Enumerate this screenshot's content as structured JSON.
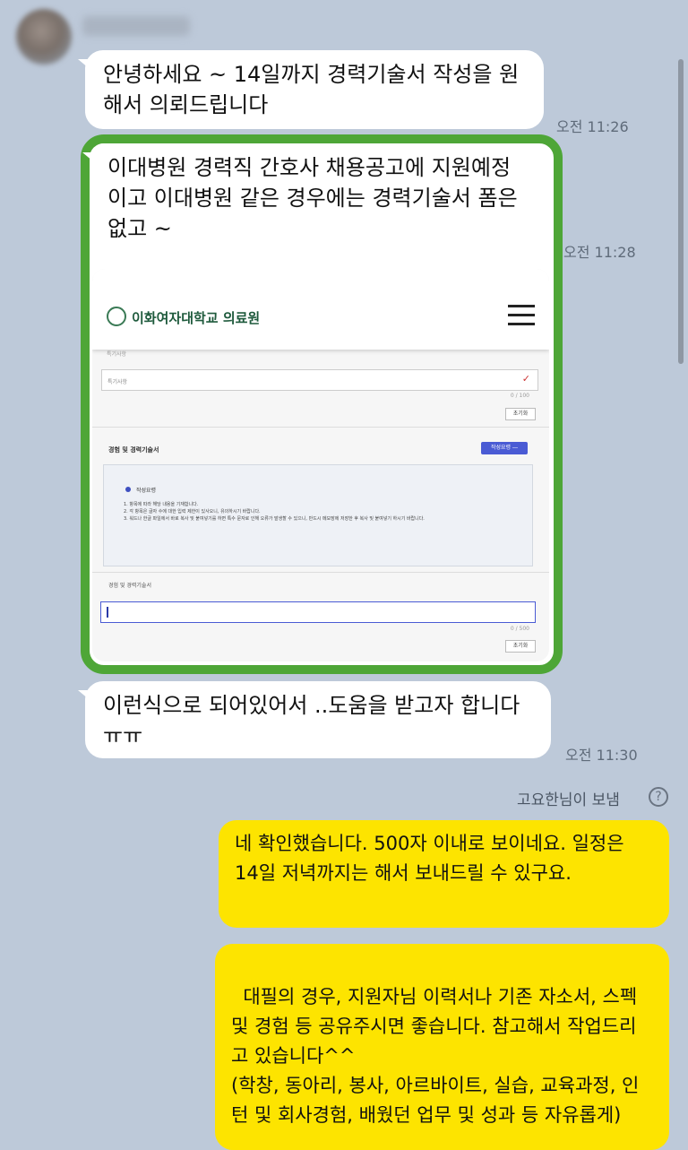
{
  "chat": {
    "messages": [
      {
        "text": "안녕하세요 ~ 14일까지 경력기술서 작성을 원해서 의뢰드립니다",
        "time": "오전 11:26"
      },
      {
        "text": "이대병원 경력직 간호사 채용공고에 지원예정이고 이대병원 같은 경우에는 경력기술서 폼은 없고 ~",
        "time": "오전 11:28"
      },
      {
        "text": "이런식으로 되어있어서 ..도움을 받고자 합니다 ㅠㅠ",
        "time": "오전 11:30"
      }
    ],
    "sent_by_label": "고요한님이 보냄",
    "help_icon": "?",
    "replies": [
      {
        "text": "네 확인했습니다. 500자 이내로 보이네요. 일정은 14일 저녁까지는 해서 보내드릴 수 있구요."
      },
      {
        "text": "대필의 경우, 지원자님 이력서나 기존 자소서, 스펙 및 경험 등 공유주시면 좋습니다. 참고해서 작업드리고 있습니다^^\n(학창, 동아리, 봉사, 아르바이트, 실습, 교육과정, 인턴 및 회사경험, 배웠던 업무 및 성과 등 자유롭게)"
      }
    ]
  },
  "embedded_screenshot": {
    "hospital_name": "이화여자대학교 의료원",
    "field1_label": "특기사항",
    "field1_value": "특기사항",
    "field1_counter": "0 / 100",
    "reset_button": "초기화",
    "section_title": "경험 및 경력기술서",
    "blue_button": "작성요령 ―",
    "guide_title": "작성요령",
    "guide_lines": [
      "1. 항목에 따라 해당 내용을 기재합니다.",
      "2. 각 항목은 글자 수에 대한 입력 제한이 있사오니, 유의하시기 바랍니다.",
      "3. 워드나 한글 파일에서 바로 복사 및 붙여넣기를 하면 특수 문자로 인해 오류가 발생할 수 있으니, 반드시 메모장에 저장한 후 복사 및 붙여넣기 하시기 바랍니다."
    ],
    "field2_label": "경험 및 경력기술서",
    "field2_counter": "0 / 500",
    "reset_button2": "초기화"
  },
  "colors": {
    "background": "#bdc9d9",
    "incoming_bubble": "#ffffff",
    "outgoing_bubble": "#fde400",
    "highlight_frame": "#4ea637"
  }
}
